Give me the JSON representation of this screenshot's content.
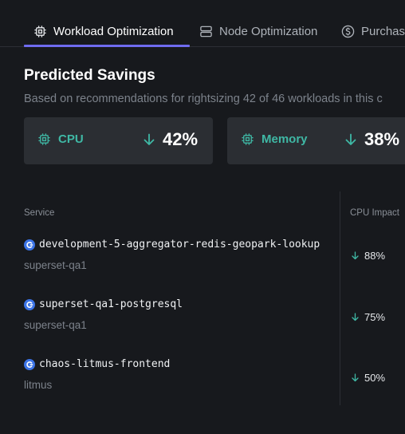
{
  "tabs": [
    {
      "label": "Workload Optimization",
      "icon": "cpu-icon",
      "active": true
    },
    {
      "label": "Node Optimization",
      "icon": "server-icon",
      "active": false
    },
    {
      "label": "Purchas",
      "icon": "dollar-circle-icon",
      "active": false
    }
  ],
  "header": {
    "title": "Predicted Savings",
    "subtitle": "Based on recommendations for rightsizing  42 of 46 workloads in this c"
  },
  "cards": [
    {
      "label": "CPU",
      "icon": "cpu-icon",
      "value": "42%",
      "trend_icon": "arrow-down-icon"
    },
    {
      "label": "Memory",
      "icon": "cpu-icon",
      "value": "38%",
      "trend_icon": "arrow-down-icon"
    }
  ],
  "table": {
    "columns": [
      "Service",
      "CPU Impact"
    ],
    "rows": [
      {
        "service": "development-5-aggregator-redis-geopark-lookup",
        "namespace": "superset-qa1",
        "cpu_impact": "88%"
      },
      {
        "service": "superset-qa1-postgresql",
        "namespace": "superset-qa1",
        "cpu_impact": "75%"
      },
      {
        "service": "chaos-litmus-frontend",
        "namespace": "litmus",
        "cpu_impact": "50%"
      }
    ]
  },
  "colors": {
    "background": "#17191d",
    "card": "#2b2e33",
    "accent_teal": "#3fb8a5",
    "tab_underline": "#6f6cf0",
    "service_icon": "#3b73e6"
  }
}
